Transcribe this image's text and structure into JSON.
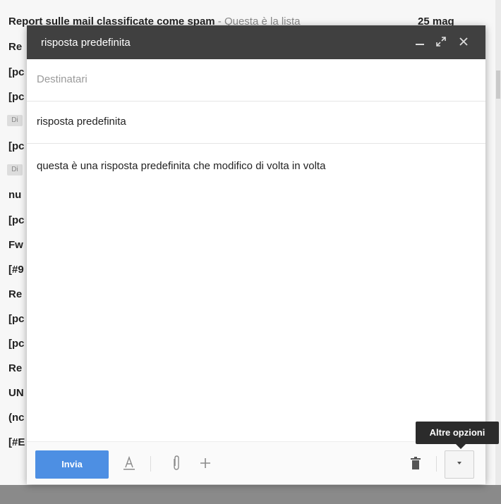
{
  "inbox": {
    "first_row": {
      "subject": "Report sulle mail classificate come spam",
      "snippet": " - Questa è la lista",
      "date": "25 mag"
    },
    "rows": [
      "Re",
      "[pc",
      "[pc",
      "Di",
      "[pc",
      "Di",
      "nu",
      "[pc",
      "Fw",
      "[#9",
      "Re",
      "[pc",
      "[pc",
      "Re",
      "UN",
      "(nc",
      "[#E"
    ]
  },
  "compose": {
    "title": "risposta predefinita",
    "minimize_icon": "minimize-icon",
    "expand_icon": "expand-icon",
    "close_icon": "close-icon",
    "to_placeholder": "Destinatari",
    "subject": "risposta predefinita",
    "body": "questa è una risposta predefinita che modifico di volta in volta",
    "toolbar": {
      "send_label": "Invia",
      "formatting_icon": "text-format-icon",
      "attach_icon": "paperclip-icon",
      "insert_icon": "plus-icon",
      "trash_icon": "trash-icon",
      "more_icon": "chevron-down-icon"
    },
    "tooltip": "Altre opzioni"
  },
  "colors": {
    "header_bg": "#404040",
    "send_button": "#4d8fe3",
    "tooltip_bg": "#2b2b2b"
  }
}
